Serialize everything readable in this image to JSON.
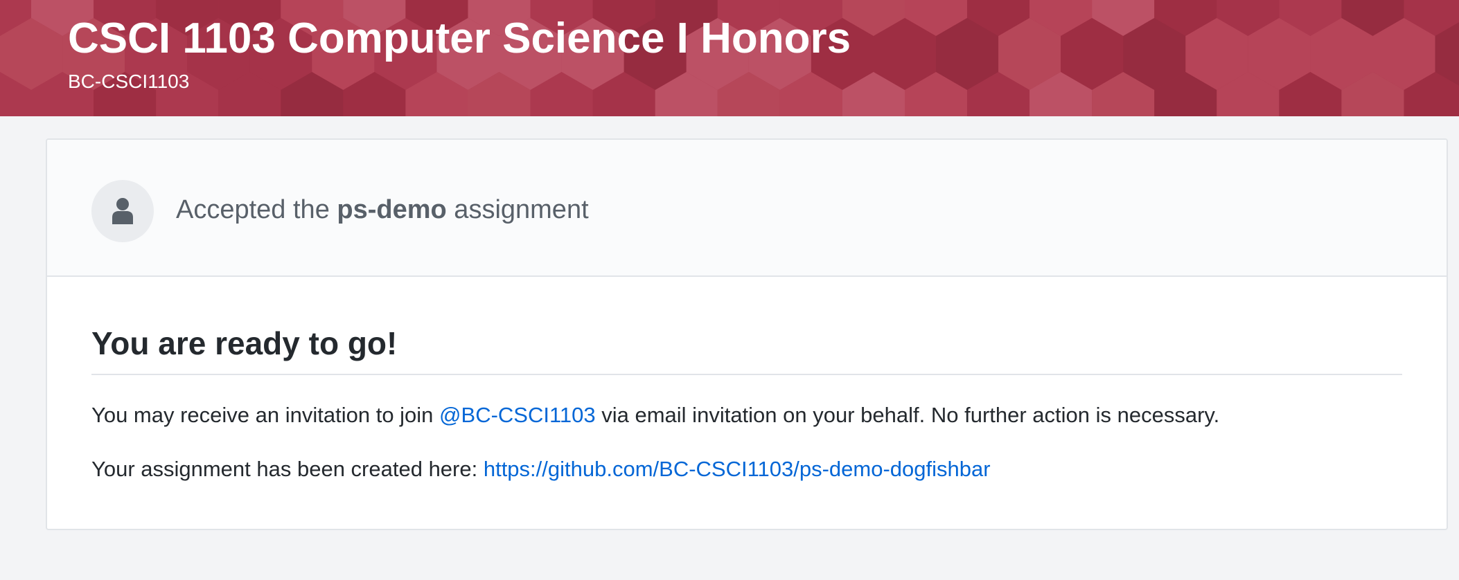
{
  "header": {
    "title": "CSCI 1103 Computer Science I Honors",
    "subtitle": "BC-CSCI1103",
    "background_color": "#a7354a"
  },
  "accepted": {
    "avatar_icon": "user-icon",
    "prefix": "Accepted the ",
    "assignment_name": "ps-demo",
    "suffix": " assignment"
  },
  "main": {
    "heading": "You are ready to go!",
    "invitation": {
      "before": "You may receive an invitation to join ",
      "org_link": "@BC-CSCI1103",
      "after": " via email invitation on your behalf. No further action is necessary."
    },
    "repository": {
      "label": "Your assignment has been created here: ",
      "url": "https://github.com/BC-CSCI1103/ps-demo-dogfishbar"
    }
  },
  "colors": {
    "link": "#0366d6",
    "muted_text": "#586069"
  }
}
